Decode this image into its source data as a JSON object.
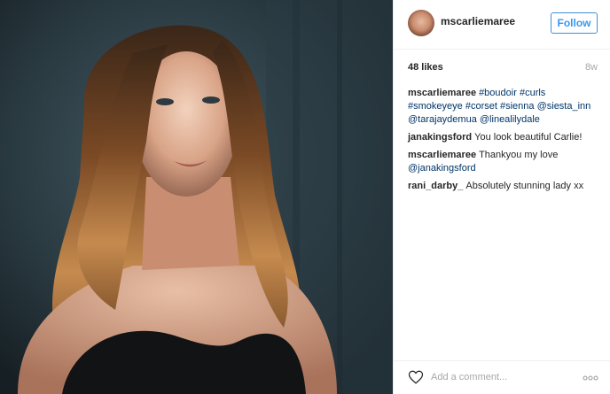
{
  "header": {
    "username": "mscarliemaree",
    "follow_label": "Follow",
    "avatar_icon": "profile-avatar"
  },
  "stats": {
    "likes": "48 likes",
    "time_ago": "8w"
  },
  "comments": [
    {
      "author": "mscarliemaree",
      "parts": [
        {
          "type": "tag",
          "text": "#boudoir"
        },
        {
          "type": "tag",
          "text": "#curls"
        },
        {
          "type": "tag",
          "text": "#smokeyeye"
        },
        {
          "type": "tag",
          "text": "#corset"
        },
        {
          "type": "tag",
          "text": "#sienna"
        },
        {
          "type": "mention",
          "text": "@siesta_inn"
        },
        {
          "type": "mention",
          "text": "@tarajaydemua"
        },
        {
          "type": "mention",
          "text": "@linealilydale"
        }
      ]
    },
    {
      "author": "janakingsford",
      "parts": [
        {
          "type": "text",
          "text": "You look beautiful Carlie!"
        }
      ]
    },
    {
      "author": "mscarliemaree",
      "parts": [
        {
          "type": "text",
          "text": "Thankyou my love "
        },
        {
          "type": "mention",
          "text": "@janakingsford"
        }
      ]
    },
    {
      "author": "rani_darby_",
      "parts": [
        {
          "type": "text",
          "text": "Absolutely stunning lady xx"
        }
      ]
    }
  ],
  "footer": {
    "comment_placeholder": "Add a comment...",
    "like_icon": "heart-outline",
    "more_icon": "ellipsis"
  },
  "colors": {
    "follow_accent": "#3897f0",
    "link_color": "#003569",
    "muted_text": "#a5a7aa"
  }
}
